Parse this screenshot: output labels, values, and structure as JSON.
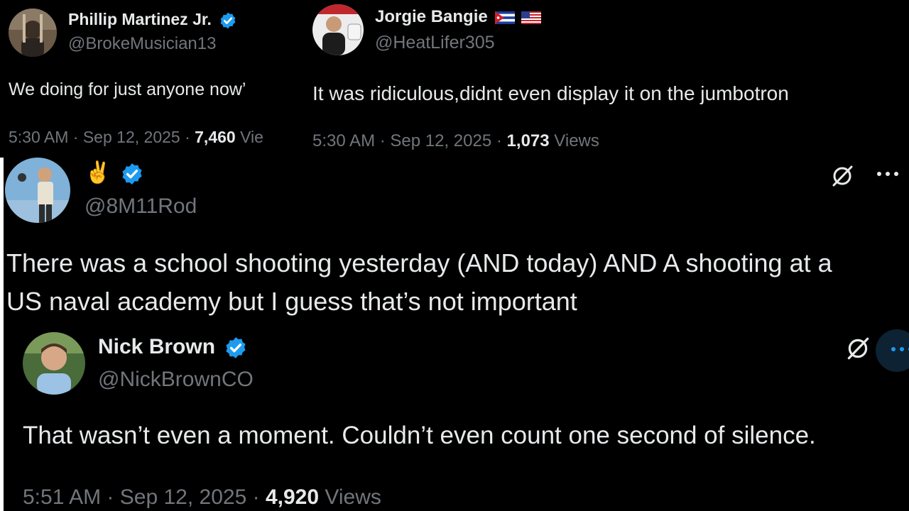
{
  "tweets": [
    {
      "name": "Phillip Martinez Jr.",
      "handle": "@BrokeMusician13",
      "text": "We doing for just anyone now’",
      "time": "5:30 AM",
      "date": "Sep 12, 2025",
      "views_count": "7,460",
      "views_label": "Vie",
      "verified": true
    },
    {
      "name": "Jorgie Bangie",
      "handle": "@HeatLifer305",
      "text": "It was ridiculous,didnt even display it on the jumbotron",
      "time": "5:30 AM",
      "date": "Sep 12, 2025",
      "views_count": "1,073",
      "views_label": "Views",
      "flags": [
        "cuba-flag",
        "us-flag"
      ]
    },
    {
      "name": "✌️",
      "handle": "@8M11Rod",
      "text_lines": [
        "There was a school shooting yesterday (AND today) AND A shooting at a",
        "US naval academy but I guess that’s not important"
      ],
      "verified": true
    },
    {
      "name": "Nick Brown",
      "handle": "@NickBrownCO",
      "text": "That wasn’t even a moment. Couldn’t even count one second of silence.",
      "time": "5:51 AM",
      "date": "Sep 12, 2025",
      "views_count": "4,920",
      "views_label": "Views",
      "verified": true
    }
  ],
  "sep": "·",
  "icons": [
    "grok-icon",
    "more-icon"
  ],
  "colors": {
    "bg": "#000000",
    "text": "#e7e9ea",
    "muted": "#71767b",
    "verified": "#1d9bf0"
  }
}
